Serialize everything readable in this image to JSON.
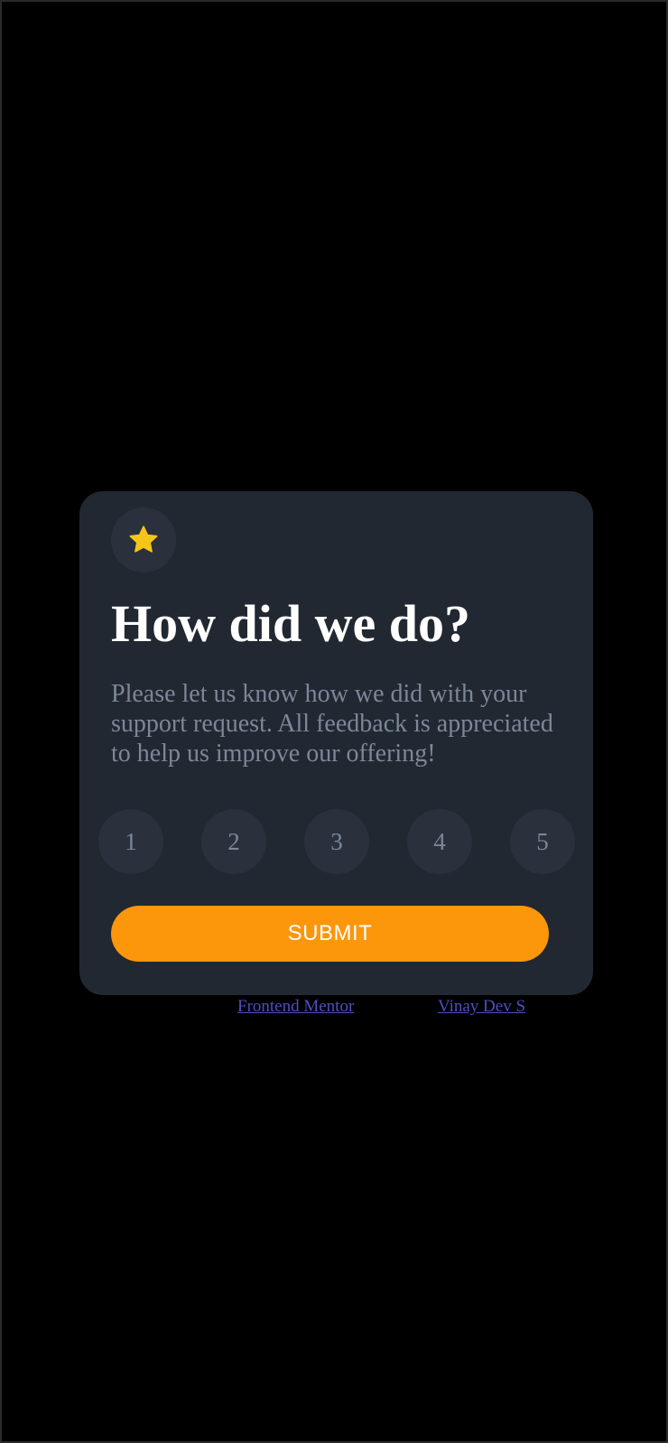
{
  "card": {
    "icon": "star-icon",
    "title": "How did we do?",
    "description": "Please let us know how we did with your support request. All feedback is appreciated to help us improve our offering!",
    "ratings": [
      "1",
      "2",
      "3",
      "4",
      "5"
    ],
    "submit_label": "SUBMIT"
  },
  "attribution": {
    "frontend_mentor": "Frontend Mentor",
    "author": "Vinay Dev S"
  },
  "colors": {
    "page_background": "#000000",
    "card_background": "#222831",
    "rating_background": "#2a313c",
    "accent": "#fc960b",
    "star": "#f5c518",
    "muted_text": "#7c8798",
    "link": "#4e4fbf"
  }
}
